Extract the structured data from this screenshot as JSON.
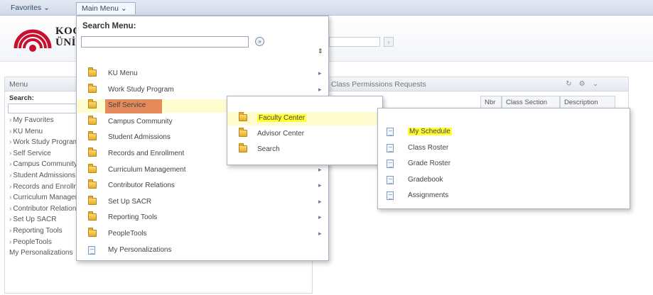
{
  "topbar": {
    "favorites_label": "Favorites ⌄",
    "main_menu_label": "Main Menu ⌄"
  },
  "header": {
    "logo_text_line1": "KOÇ",
    "logo_text_line2": "ÜNİ"
  },
  "menu_pagelet": {
    "title": "Menu",
    "search_label": "Search:",
    "items": [
      "My Favorites",
      "KU Menu",
      "Work Study Program",
      "Self Service",
      "Campus Community",
      "Student Admissions",
      "Records and Enrollment",
      "Curriculum Management",
      "Contributor Relations",
      "Set Up SACR",
      "Reporting Tools",
      "PeopleTools",
      "My Personalizations"
    ]
  },
  "class_pagelet": {
    "title": "Class Permissions Requests",
    "columns": [
      "Nbr",
      "Class Section",
      "Description"
    ]
  },
  "main_menu_panel": {
    "title": "Search Menu:",
    "search_value": "",
    "go_icon": "circle-arrow-icon",
    "sort_icon": "sort-icon",
    "items": [
      {
        "label": "KU Menu",
        "type": "folder",
        "submenu": true
      },
      {
        "label": "Work Study Program",
        "type": "folder",
        "submenu": true
      },
      {
        "label": "Self Service",
        "type": "folder",
        "submenu": true,
        "selected": true
      },
      {
        "label": "Campus Community",
        "type": "folder",
        "submenu": true
      },
      {
        "label": "Student Admissions",
        "type": "folder",
        "submenu": true
      },
      {
        "label": "Records and Enrollment",
        "type": "folder",
        "submenu": true
      },
      {
        "label": "Curriculum Management",
        "type": "folder",
        "submenu": true
      },
      {
        "label": "Contributor Relations",
        "type": "folder",
        "submenu": true
      },
      {
        "label": "Set Up SACR",
        "type": "folder",
        "submenu": true
      },
      {
        "label": "Reporting Tools",
        "type": "folder",
        "submenu": true
      },
      {
        "label": "PeopleTools",
        "type": "folder",
        "submenu": true
      },
      {
        "label": "My Personalizations",
        "type": "page",
        "submenu": false
      }
    ]
  },
  "self_service_panel": {
    "items": [
      {
        "label": "Faculty Center",
        "type": "folder",
        "selected": true
      },
      {
        "label": "Advisor Center",
        "type": "folder"
      },
      {
        "label": "Search",
        "type": "folder"
      }
    ]
  },
  "faculty_center_panel": {
    "items": [
      {
        "label": "My Schedule",
        "type": "page",
        "highlighted": true
      },
      {
        "label": "Class Roster",
        "type": "page"
      },
      {
        "label": "Grade Roster",
        "type": "page"
      },
      {
        "label": "Gradebook",
        "type": "page"
      },
      {
        "label": "Assignments",
        "type": "page"
      }
    ]
  },
  "colors": {
    "highlight_yellow": "#ffff33",
    "selected_red": "#e58a5a",
    "brand_red": "#c8102e"
  }
}
